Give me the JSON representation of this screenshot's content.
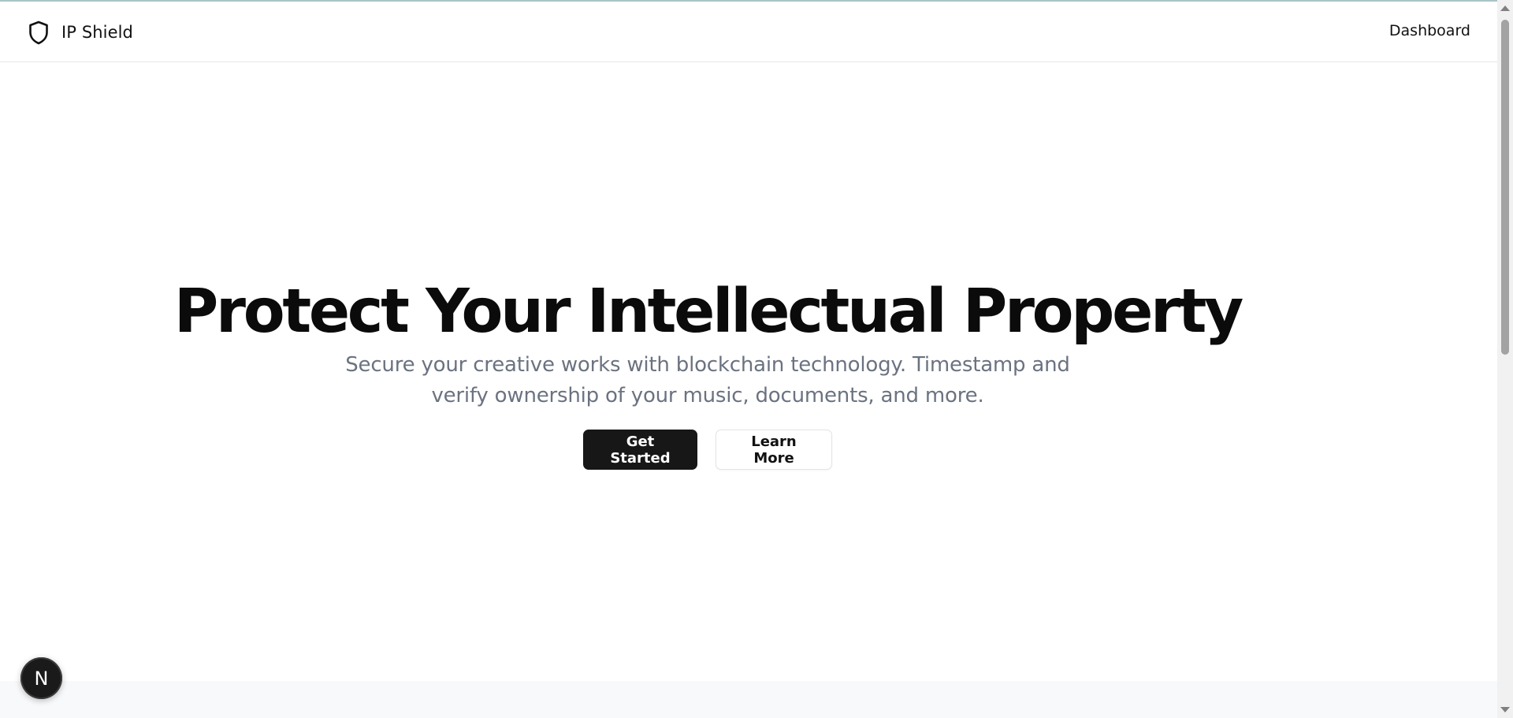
{
  "header": {
    "brand_name": "IP Shield",
    "brand_icon": "shield-icon",
    "nav_dashboard": "Dashboard"
  },
  "hero": {
    "title": "Protect Your Intellectual Property",
    "subtitle": "Secure your creative works with blockchain technology. Timestamp and verify ownership of your music, documents, and more.",
    "primary_button": "Get Started",
    "secondary_button": "Learn More"
  },
  "dev_badge": {
    "label": "N",
    "icon": "nextjs-icon"
  },
  "colors": {
    "primary_button_bg": "#171717",
    "subtitle_text": "#6b7280",
    "heading_text": "#0b0b0b"
  }
}
